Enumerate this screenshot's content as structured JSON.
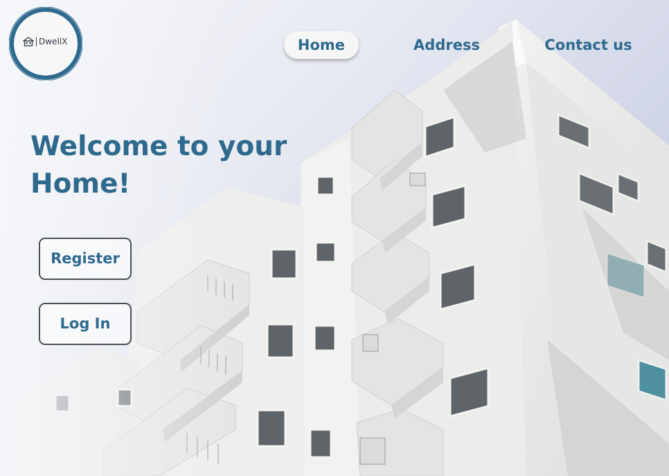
{
  "logo": {
    "brand": "DwellX",
    "icon": "house-icon"
  },
  "nav": {
    "items": [
      {
        "label": "Home",
        "active": true
      },
      {
        "label": "Address",
        "active": false
      },
      {
        "label": "Contact us",
        "active": false
      }
    ]
  },
  "hero": {
    "title_line1": "Welcome to your",
    "title_line2": "Home!"
  },
  "actions": {
    "register_label": "Register",
    "login_label": "Log In"
  },
  "colors": {
    "accent": "#2e6a8e",
    "active_nav_bg": "#f6f6f6",
    "building": "#ededeb",
    "sky": "#cfd4e6"
  }
}
